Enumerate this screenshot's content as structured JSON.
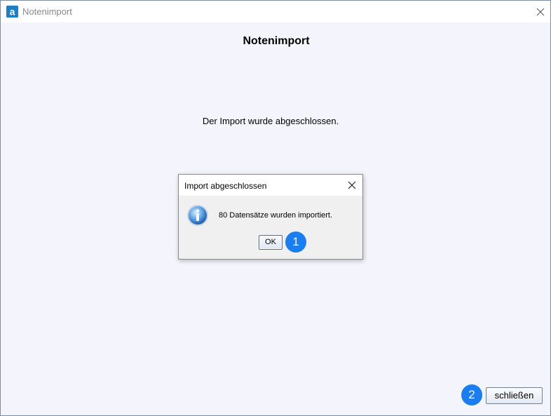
{
  "window": {
    "title": "Notenimport",
    "app_icon": "a"
  },
  "main": {
    "heading": "Notenimport",
    "status_text": "Der Import wurde abgeschlossen."
  },
  "dialog": {
    "title": "Import abgeschlossen",
    "message": "80 Datensätze wurden importiert.",
    "ok_label": "OK",
    "icon": "info-icon"
  },
  "callouts": {
    "one": "1",
    "two": "2"
  },
  "footer": {
    "close_label": "schließen"
  },
  "colors": {
    "callout": "#1a7ef0",
    "app_icon": "#1f7fc4",
    "background": "#f4f4fc"
  }
}
